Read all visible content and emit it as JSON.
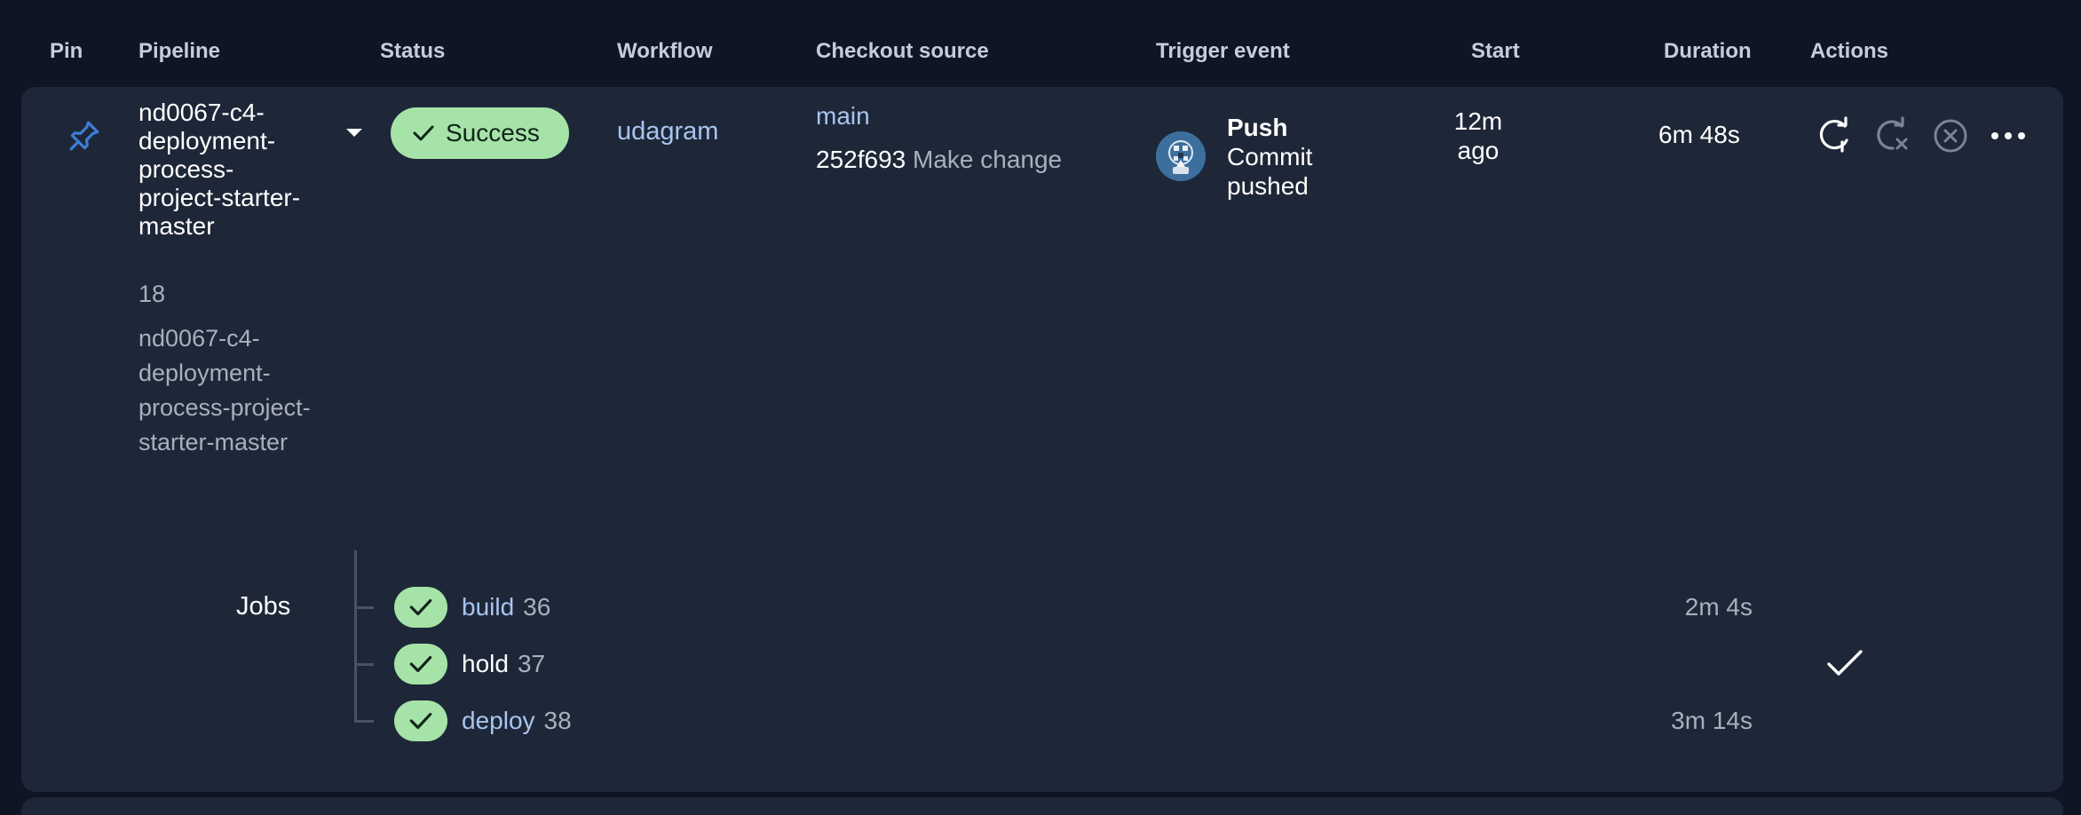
{
  "columns": {
    "pin": "Pin",
    "pipeline": "Pipeline",
    "status": "Status",
    "workflow": "Workflow",
    "checkout": "Checkout source",
    "trigger": "Trigger event",
    "start": "Start",
    "duration": "Duration",
    "actions": "Actions"
  },
  "pipeline": {
    "name": "nd0067-c4-deployment-process-project-starter-master",
    "number": "18",
    "slug": "nd0067-c4-deployment-process-project-starter-master",
    "status": "Success",
    "workflow": "udagram",
    "branch": "main",
    "commit_sha": "252f693",
    "commit_message": "Make change",
    "trigger_type": "Push",
    "trigger_desc": "Commit pushed",
    "start": "12m ago",
    "duration": "6m 48s"
  },
  "jobs": {
    "label": "Jobs",
    "items": [
      {
        "name": "build",
        "number": "36",
        "duration": "2m 4s"
      },
      {
        "name": "hold",
        "number": "37",
        "duration": ""
      },
      {
        "name": "deploy",
        "number": "38",
        "duration": "3m 14s"
      }
    ]
  },
  "colors": {
    "background": "#0f1524",
    "card": "#1e2738",
    "success": "#a6e3a8",
    "link": "#a8c4f0",
    "pin": "#3e7fd6"
  },
  "icons": [
    "pin-icon",
    "chevron-down-icon",
    "check-icon",
    "rerun-icon",
    "rerun-failed-icon",
    "cancel-icon",
    "more-icon",
    "approve-check-icon"
  ]
}
